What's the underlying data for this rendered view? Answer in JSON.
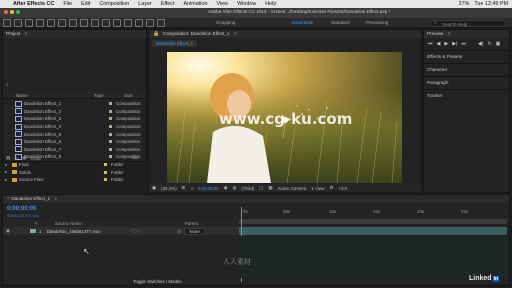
{
  "menubar": {
    "app_name": "After Effects CC",
    "items": [
      "File",
      "Edit",
      "Composition",
      "Layer",
      "Effect",
      "Animation",
      "View",
      "Window",
      "Help"
    ],
    "right": [
      "27%",
      "Tue 12:49 PM"
    ]
  },
  "appbar": {
    "path": "Adobe After Effects CC 2015 - /Users/.../Desktop/Exercise Files/04/Dandelion Effect.aep *"
  },
  "toolbar": {
    "workspaces": [
      "Snapping",
      "Essentials",
      "Standard",
      "Previewing"
    ],
    "active_workspace": "Essentials",
    "search_placeholder": "Search Help"
  },
  "project": {
    "title": "Project",
    "columns": [
      "Name",
      "Type",
      "Size"
    ],
    "items": [
      {
        "name": "Dandelion Effect_1",
        "type": "Composition",
        "kind": "comp",
        "color": "#bda98a"
      },
      {
        "name": "Dandelion Effect_2",
        "type": "Composition",
        "kind": "comp",
        "color": "#bda98a"
      },
      {
        "name": "Dandelion Effect_3",
        "type": "Composition",
        "kind": "comp",
        "color": "#bda98a"
      },
      {
        "name": "Dandelion Effect_4",
        "type": "Composition",
        "kind": "comp",
        "color": "#bda98a"
      },
      {
        "name": "Dandelion Effect_5",
        "type": "Composition",
        "kind": "comp",
        "color": "#bda98a"
      },
      {
        "name": "Dandelion Effect_6",
        "type": "Composition",
        "kind": "comp",
        "color": "#bda98a"
      },
      {
        "name": "Dandelion Effect_7",
        "type": "Composition",
        "kind": "comp",
        "color": "#bda98a"
      },
      {
        "name": "Dandelion Effect_8",
        "type": "Composition",
        "kind": "comp",
        "color": "#bda98a"
      },
      {
        "name": "Final",
        "type": "Folder",
        "kind": "folder",
        "color": "#d3c15e"
      },
      {
        "name": "Solids",
        "type": "Folder",
        "kind": "folder",
        "color": "#d3c15e"
      },
      {
        "name": "Source Files",
        "type": "Folder",
        "kind": "folder",
        "color": "#d3c15e"
      }
    ],
    "bpc": "8 bpc"
  },
  "composition": {
    "tab": "Composition: Dandelion Effect_1",
    "sub_tab": "Dandelion Effect_1",
    "watermark": "www.cg-ku.com",
    "footer": {
      "zoom": "(30.4%)",
      "time": "0;00;00;00",
      "resolution": "(Third)",
      "camera": "Active Camera",
      "view": "1 View",
      "exposure": "+0.0"
    }
  },
  "right_panel": {
    "preview_title": "Preview",
    "sections": [
      "Effects & Presets",
      "Character",
      "Paragraph",
      "Tracker"
    ]
  },
  "timeline": {
    "tab": "Dandelion Effect_1",
    "timecode": "0;00;00;00",
    "fps": "00000 (23.976 fps)",
    "columns": [
      "#",
      "Source Name",
      "Parent"
    ],
    "layer": {
      "index": "1",
      "name": "Dandelion_158461377.mov",
      "parent": "None"
    },
    "ruler": [
      "0s",
      "05s",
      "10s",
      "15s",
      "20s",
      "25s"
    ],
    "bottom_button": "Toggle Switches / Modes",
    "brand": "Linked",
    "brand_in": "in",
    "watermark_bottom": "人人素材"
  },
  "colors": {
    "accent": "#3aa0ff",
    "timecode": "#4f8fd9",
    "layer_bar": "#3b5e61"
  }
}
